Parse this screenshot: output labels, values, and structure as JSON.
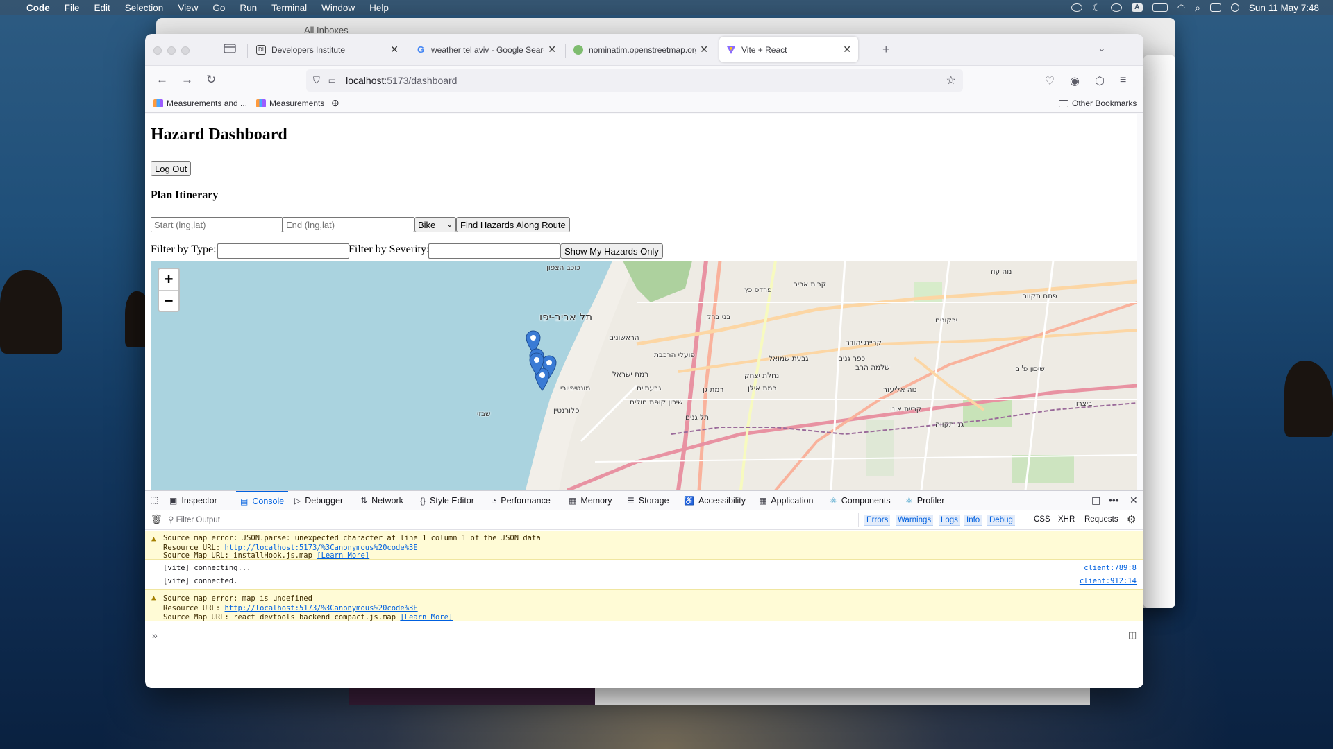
{
  "menubar": {
    "app": "Code",
    "items": [
      "File",
      "Edit",
      "Selection",
      "View",
      "Go",
      "Run",
      "Terminal",
      "Window",
      "Help"
    ],
    "clock": "Sun 11 May  7:48"
  },
  "bg_window": {
    "title": "All Inboxes"
  },
  "tabs": [
    {
      "label": "Developers Institute",
      "icon": "developers-icon"
    },
    {
      "label": "weather tel aviv - Google Search",
      "icon": "google-icon"
    },
    {
      "label": "nominatim.openstreetmap.org/r",
      "icon": "osm-icon"
    },
    {
      "label": "Vite + React",
      "icon": "vite-icon"
    }
  ],
  "url": {
    "host": "localhost",
    "path": ":5173/dashboard"
  },
  "bookmarks": {
    "items": [
      "Measurements and ...",
      "Measurements"
    ],
    "other": "Other Bookmarks"
  },
  "page": {
    "title": "Hazard Dashboard",
    "logout": "Log Out",
    "plan_heading": "Plan Itinerary",
    "start_placeholder": "Start (lng,lat)",
    "end_placeholder": "End (lng,lat)",
    "mode": "Bike",
    "find_button": "Find Hazards Along Route",
    "filter_type_label": "Filter by Type:",
    "filter_severity_label": "Filter by Severity:",
    "my_hazards_button": "Show My Hazards Only"
  },
  "map": {
    "zoom_in": "+",
    "zoom_out": "−",
    "labels": [
      "כוכב הצפון",
      "פרדס כץ",
      "קרית אריה",
      "נוה עוז",
      "תל אביב-יפו",
      "בני ברק",
      "פתח תקווה",
      "הראשונים",
      "פועלי הרכבת",
      "גבעת שמואל",
      "כפר גנים",
      "מונטיפיורי",
      "רמת ישראל",
      "רמת גן",
      "רמת אילן",
      "קריית אונו",
      "גבעתיים",
      "נחלת יצחק",
      "שבזי",
      "נוה אליעזר",
      "תל גנים",
      "ירקונים",
      "שיכון קופת חולים",
      "גני תקווה",
      "שיכון פ\"ם",
      "שלמה הרב",
      "קריית יהודה",
      "פלורנטין",
      "ביצרון"
    ],
    "markers": 5
  },
  "devtools": {
    "tabs": [
      "Inspector",
      "Console",
      "Debugger",
      "Network",
      "Style Editor",
      "Performance",
      "Memory",
      "Storage",
      "Accessibility",
      "Application",
      "Components",
      "Profiler"
    ],
    "active_tab": "Console",
    "filter_placeholder": "Filter Output",
    "levels": [
      "Errors",
      "Warnings",
      "Logs",
      "Info",
      "Debug"
    ],
    "extra": [
      "CSS",
      "XHR",
      "Requests"
    ],
    "messages": [
      {
        "type": "warning",
        "line1": "Source map error: JSON.parse: unexpected character at line 1 column 1 of the JSON data",
        "resource_label": "Resource URL: ",
        "resource_url": "http://localhost:5173/%3Canonymous%20code%3E",
        "map_label": "Source Map URL: installHook.js.map ",
        "learn": "[Learn More]"
      },
      {
        "type": "log",
        "text": "[vite] connecting...",
        "src": "client:789:8"
      },
      {
        "type": "log",
        "text": "[vite] connected.",
        "src": "client:912:14"
      },
      {
        "type": "warning",
        "line1": "Source map error: map is undefined",
        "resource_label": "Resource URL: ",
        "resource_url": "http://localhost:5173/%3Canonymous%20code%3E",
        "map_label": "Source Map URL: react_devtools_backend_compact.js.map ",
        "learn": "[Learn More]"
      }
    ]
  },
  "colors": {
    "accent": "#0060df",
    "warning_bg": "#fffbd6",
    "marker": "#3a7bd5",
    "sea": "#aad3df"
  }
}
